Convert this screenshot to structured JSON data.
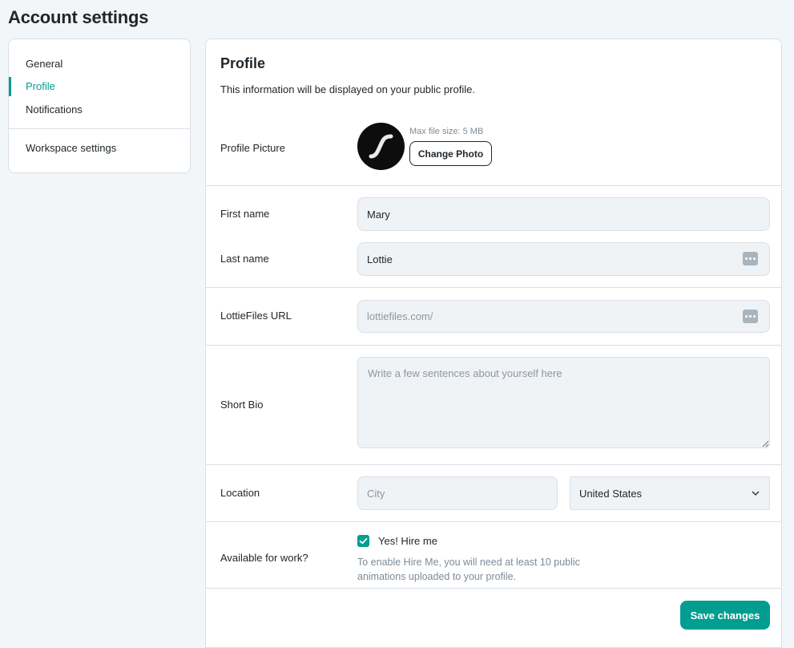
{
  "page": {
    "title": "Account settings"
  },
  "sidebar": {
    "items": [
      {
        "label": "General"
      },
      {
        "label": "Profile",
        "active": true
      },
      {
        "label": "Notifications"
      },
      {
        "label": "Workspace settings"
      }
    ]
  },
  "profile": {
    "title": "Profile",
    "subtitle": "This information will be displayed on your public profile.",
    "picture": {
      "label": "Profile Picture",
      "max_size": "Max file size: 5 MB",
      "change_label": "Change Photo"
    },
    "first_name": {
      "label": "First name",
      "value": "Mary"
    },
    "last_name": {
      "label": "Last name",
      "value": "Lottie"
    },
    "url": {
      "label": "LottieFiles URL",
      "placeholder": "lottiefiles.com/"
    },
    "bio": {
      "label": "Short Bio",
      "placeholder": "Write a few sentences about yourself here"
    },
    "location": {
      "label": "Location",
      "city_placeholder": "City",
      "country": "United States"
    },
    "work": {
      "label": "Available for work?",
      "checkbox_label": "Yes! Hire me",
      "checked": true,
      "hint": "To enable Hire Me, you will need at least 10 public animations uploaded to your profile."
    },
    "save_label": "Save changes"
  },
  "colors": {
    "accent": "#019d91",
    "background": "#f3f6f8",
    "text": "#20272c",
    "muted": "#7e8b96"
  }
}
